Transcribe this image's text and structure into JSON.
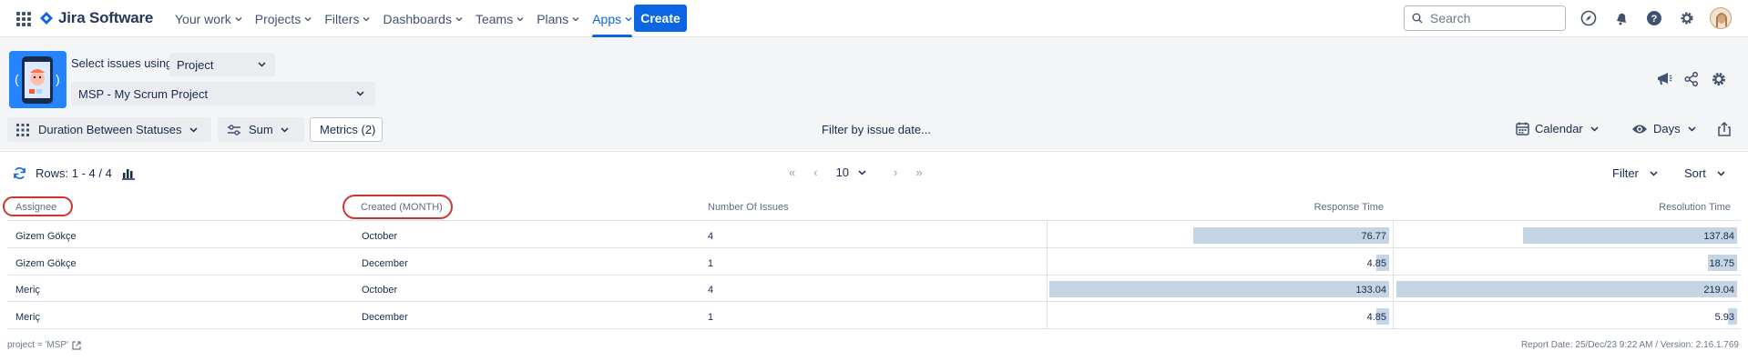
{
  "topnav": {
    "brand": "Jira Software",
    "menu": [
      {
        "label": "Your work"
      },
      {
        "label": "Projects"
      },
      {
        "label": "Filters"
      },
      {
        "label": "Dashboards"
      },
      {
        "label": "Teams"
      },
      {
        "label": "Plans"
      },
      {
        "label": "Apps"
      }
    ],
    "active_menu": "Apps",
    "create_label": "Create",
    "search_placeholder": "Search",
    "accent": "#0c66e4"
  },
  "selector": {
    "label": "Select issues using",
    "mode": "Project",
    "project": "MSP - My Scrum Project"
  },
  "toolbar": {
    "report_type": "Duration Between Statuses",
    "aggregation": "Sum",
    "metrics": "Metrics (2)",
    "filter_date": "Filter by issue date...",
    "calendar": "Calendar",
    "days": "Days"
  },
  "rowsbar": {
    "rows_text": "Rows: 1 - 4 / 4",
    "page_size": "10",
    "filter": "Filter",
    "sort": "Sort"
  },
  "table": {
    "headers": [
      "Assignee",
      "Created (MONTH)",
      "Number Of Issues",
      "Response Time",
      "Resolution Time"
    ],
    "response_max": 133.04,
    "resolution_max": 219.04,
    "rows": [
      {
        "assignee": "Gizem Gökçe",
        "created": "October",
        "issues": "4",
        "response": 76.77,
        "response_label": "76.77",
        "resolution": 137.84,
        "resolution_label": "137.84"
      },
      {
        "assignee": "Gizem Gökçe",
        "created": "December",
        "issues": "1",
        "response": 4.85,
        "response_label": "4.85",
        "resolution": 18.75,
        "resolution_label": "18.75"
      },
      {
        "assignee": "Meriç",
        "created": "October",
        "issues": "4",
        "response": 133.04,
        "response_label": "133.04",
        "resolution": 219.04,
        "resolution_label": "219.04"
      },
      {
        "assignee": "Meriç",
        "created": "December",
        "issues": "1",
        "response": 4.85,
        "response_label": "4.85",
        "resolution": 5.93,
        "resolution_label": "5.93"
      }
    ],
    "bar_color": "#c5d5e4",
    "highlight_color": "#d0342c"
  },
  "footer": {
    "jql": "project = 'MSP'",
    "report_info": "Report Date: 25/Dec/23 9:22 AM / Version: 2.16.1.769"
  }
}
